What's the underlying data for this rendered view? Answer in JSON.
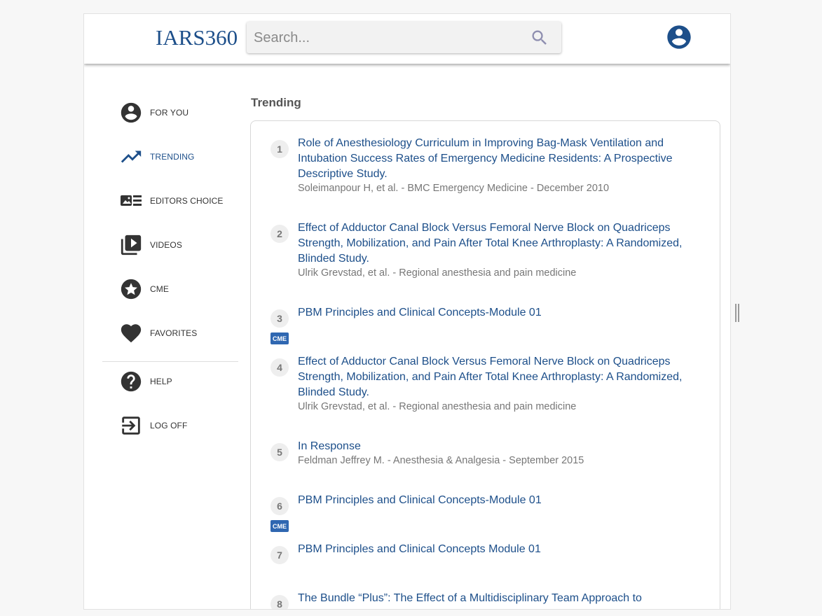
{
  "header": {
    "logo": "IARS360",
    "search_placeholder": "Search..."
  },
  "sidebar": {
    "items": [
      {
        "label": "FOR YOU",
        "icon": "account-circle-icon"
      },
      {
        "label": "TRENDING",
        "icon": "trending-up-icon"
      },
      {
        "label": "EDITORS CHOICE",
        "icon": "featured-article-icon"
      },
      {
        "label": "VIDEOS",
        "icon": "video-library-icon"
      },
      {
        "label": "CME",
        "icon": "star-circle-icon"
      },
      {
        "label": "FAVORITES",
        "icon": "heart-icon"
      },
      {
        "label": "HELP",
        "icon": "help-circle-icon"
      },
      {
        "label": "LOG OFF",
        "icon": "logout-icon"
      }
    ],
    "active": "TRENDING"
  },
  "main": {
    "section_title": "Trending",
    "badge_label": "CME",
    "items": [
      {
        "num": "1",
        "title": "Role of Anesthesiology Curriculum in Improving Bag-Mask Ventilation and Intubation Success Rates of Emergency Medicine Residents: A Prospective Descriptive Study.",
        "meta": "Soleimanpour H, et al. - BMC Emergency Medicine - December 2010"
      },
      {
        "num": "2",
        "title": "Effect of Adductor Canal Block Versus Femoral Nerve Block on Quadriceps Strength, Mobilization, and Pain After Total Knee Arthroplasty: A Randomized, Blinded Study.",
        "meta": "Ulrik Grevstad, et al. - Regional anesthesia and pain medicine"
      },
      {
        "num": "3",
        "title": "PBM Principles and Clinical Concepts-Module 01",
        "badge": "CME"
      },
      {
        "num": "4",
        "title": "Effect of Adductor Canal Block Versus Femoral Nerve Block on Quadriceps Strength, Mobilization, and Pain After Total Knee Arthroplasty: A Randomized, Blinded Study.",
        "meta": "Ulrik Grevstad, et al. - Regional anesthesia and pain medicine"
      },
      {
        "num": "5",
        "title": "In Response",
        "meta": "Feldman Jeffrey M. - Anesthesia & Analgesia - September 2015"
      },
      {
        "num": "6",
        "title": "PBM Principles and Clinical Concepts-Module 01",
        "badge": "CME"
      },
      {
        "num": "7",
        "title": "PBM Principles and Clinical Concepts Module 01"
      },
      {
        "num": "8",
        "title": "The Bundle “Plus”: The Effect of a Multidisciplinary Team Approach to"
      }
    ]
  },
  "colors": {
    "brand": "#1d4f8a",
    "badge": "#2f67b1"
  }
}
